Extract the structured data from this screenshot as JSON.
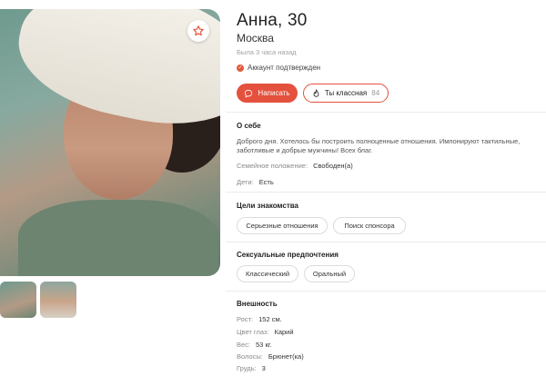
{
  "profile": {
    "name": "Анна, 30",
    "city": "Москва",
    "last_seen": "Была 3 часа назад",
    "verified_label": "Аккаунт подтвержден"
  },
  "actions": {
    "write_label": "Написать",
    "like_label": "Ты классная",
    "like_count": "84"
  },
  "about": {
    "title": "О себе",
    "text_line1": "Доброго дня. Хотелось бы построить полноценные отношения. Импонируют тактильные,",
    "text_line2": "заботливые и добрые мужчины! Всех благ.",
    "family_key": "Семейное положение:",
    "family_value": "Свободен(а)",
    "kids_key": "Дети:",
    "kids_value": "Есть"
  },
  "goals": {
    "title": "Цели знакомства",
    "items": [
      "Серьезные отношения",
      "Поиск спонсора"
    ]
  },
  "sexual": {
    "title": "Сексуальные предпочтения",
    "items": [
      "Классический",
      "Оральный"
    ]
  },
  "appearance": {
    "title": "Внешность",
    "height_key": "Рост:",
    "height_value": "152 см.",
    "eyes_key": "Цвет глаз:",
    "eyes_value": "Карий",
    "weight_key": "Вес:",
    "weight_value": "53 кг.",
    "hair_key": "Волосы:",
    "hair_value": "Брюнет(ка)",
    "chest_key": "Грудь:",
    "chest_value": "3"
  },
  "icons": {
    "favorite": "star-icon",
    "verified": "check-circle-icon",
    "write": "chat-bubble-icon",
    "like": "flame-icon"
  },
  "colors": {
    "accent": "#e4513d",
    "text_muted": "#8a8a8a"
  }
}
